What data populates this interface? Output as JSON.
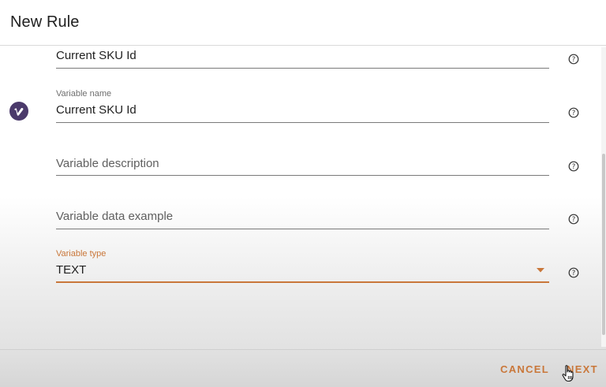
{
  "dialog": {
    "title": "New Rule"
  },
  "fields": {
    "top_value": "Current SKU Id",
    "variable_name": {
      "label": "Variable name",
      "value": "Current SKU Id"
    },
    "variable_description": {
      "placeholder": "Variable description"
    },
    "variable_data_example": {
      "placeholder": "Variable data example"
    },
    "variable_type": {
      "label": "Variable type",
      "value": "TEXT"
    }
  },
  "footer": {
    "cancel_label": "CANCEL",
    "next_label": "NEXT"
  },
  "icons": {
    "help": "help-circle-icon",
    "brand": "vimeo-icon",
    "dropdown": "caret-down-icon"
  },
  "colors": {
    "accent": "#c9773a",
    "brand_badge": "#4b3a6b",
    "text": "#1f1f1f"
  }
}
